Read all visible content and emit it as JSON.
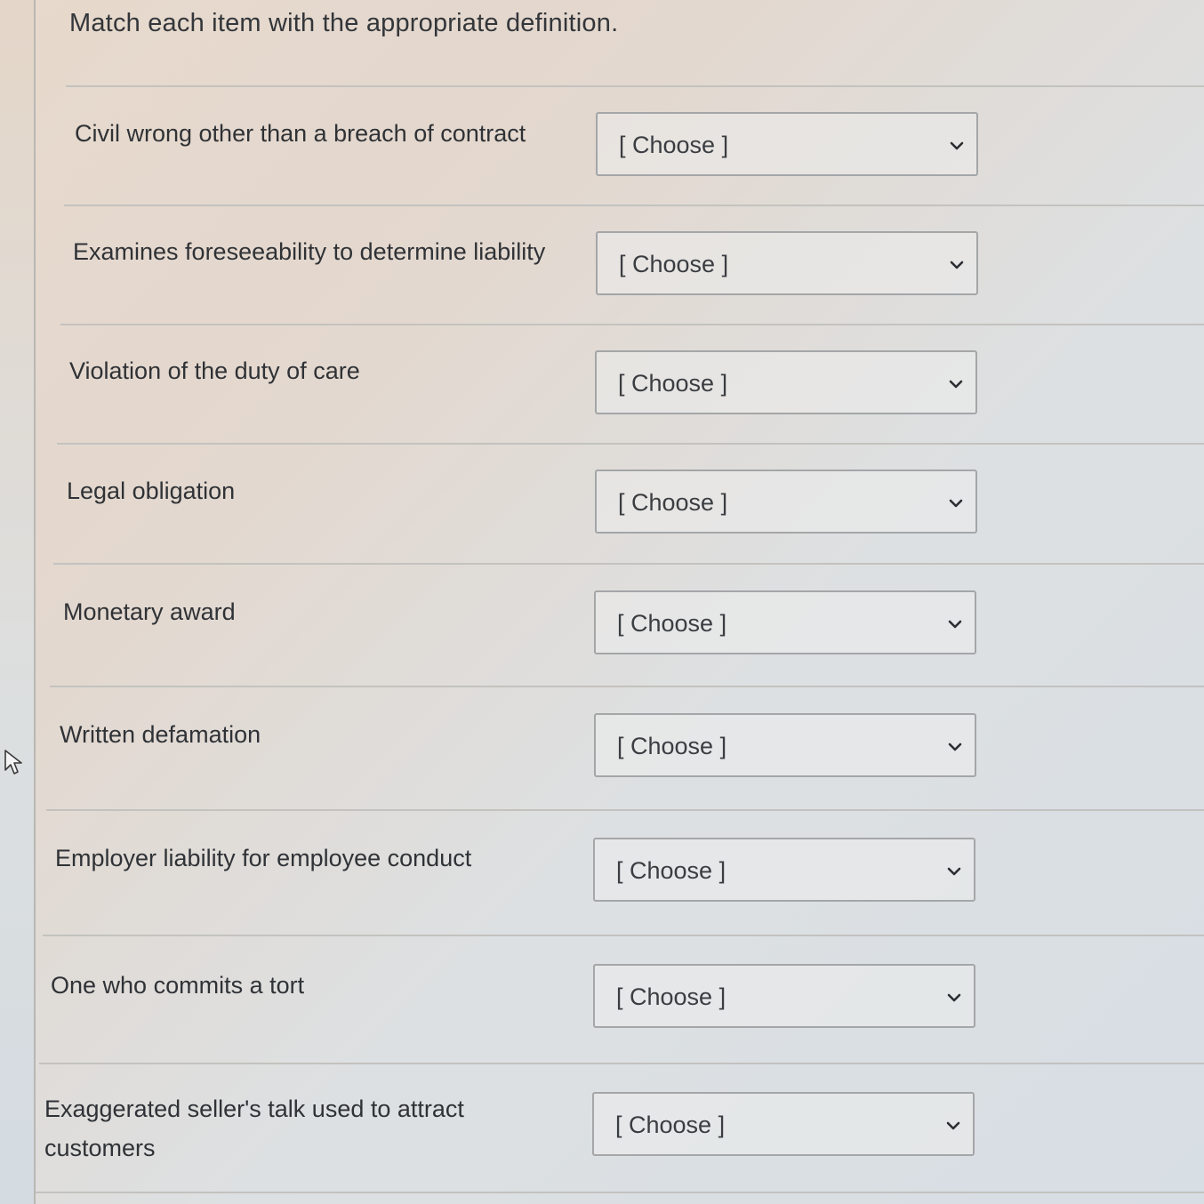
{
  "question": {
    "prompt": "Match each item with the appropriate definition."
  },
  "rows": [
    {
      "label": "Civil wrong other than a breach of contract",
      "selected": "[ Choose ]"
    },
    {
      "label": "Examines foreseeability to determine liability",
      "selected": "[ Choose ]"
    },
    {
      "label": "Violation of the duty of care",
      "selected": "[ Choose ]"
    },
    {
      "label": "Legal obligation",
      "selected": "[ Choose ]"
    },
    {
      "label": "Monetary award",
      "selected": "[ Choose ]"
    },
    {
      "label": "Written defamation",
      "selected": "[ Choose ]"
    },
    {
      "label": "Employer liability for employee conduct",
      "selected": "[ Choose ]"
    },
    {
      "label": "One who commits a tort",
      "selected": "[ Choose ]"
    },
    {
      "label": "Exaggerated seller's talk used to attract customers",
      "selected": "[ Choose ]"
    }
  ],
  "icons": {
    "dropdown": "chevron-down-icon",
    "cursor": "mouse-pointer-icon"
  }
}
